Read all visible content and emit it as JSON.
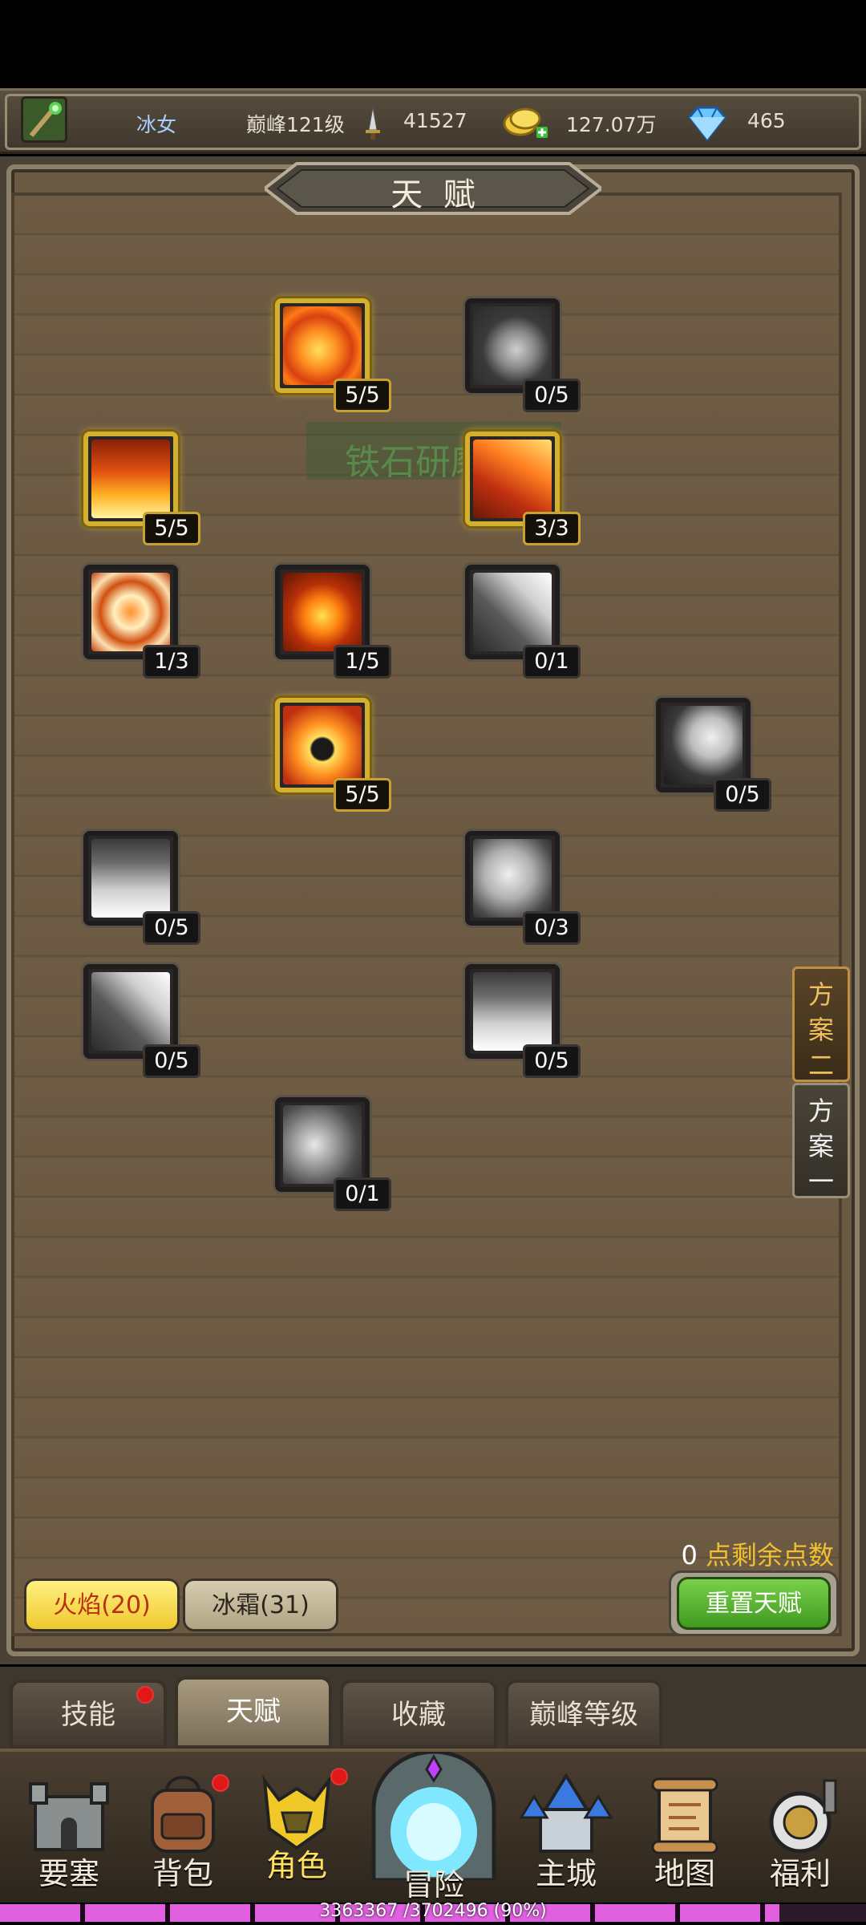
{
  "header": {
    "hero_name": "冰女",
    "peak_level": "巅峰121级",
    "power": "41527",
    "gold": "127.07万",
    "diamonds": "465"
  },
  "title": "天  赋",
  "watermark": "铁石研磨",
  "talents": [
    {
      "name": "fire-orb-talent",
      "level": "5/5",
      "active": true
    },
    {
      "name": "stone-meteor-talent",
      "level": "0/5",
      "active": false
    },
    {
      "name": "flame-burst-talent",
      "level": "5/5",
      "active": true
    },
    {
      "name": "fire-streak-talent",
      "level": "3/3",
      "active": true
    },
    {
      "name": "fire-rune-talent",
      "level": "1/3",
      "active": false
    },
    {
      "name": "fire-meteor-talent",
      "level": "1/5",
      "active": false
    },
    {
      "name": "comet-talent",
      "level": "0/1",
      "active": false
    },
    {
      "name": "warrior-flame-talent",
      "level": "5/5",
      "active": true
    },
    {
      "name": "fist-talent",
      "level": "0/5",
      "active": false
    },
    {
      "name": "white-flame-talent",
      "level": "0/5",
      "active": false
    },
    {
      "name": "rage-face-talent",
      "level": "0/3",
      "active": false
    },
    {
      "name": "comet-2-talent",
      "level": "0/5",
      "active": false
    },
    {
      "name": "white-flame-2-talent",
      "level": "0/5",
      "active": false
    },
    {
      "name": "frost-splash-talent",
      "level": "0/1",
      "active": false
    }
  ],
  "plans": {
    "plan2": "方案二",
    "plan1": "方案一"
  },
  "remaining_points": {
    "count": "0",
    "label": "点剩余点数"
  },
  "element_tabs": {
    "fire": "火焰(20)",
    "frost": "冰霜(31)"
  },
  "reset_button": "重置天赋",
  "sub_tabs": [
    "技能",
    "天赋",
    "收藏",
    "巅峰等级"
  ],
  "nav": [
    "要塞",
    "背包",
    "角色",
    "冒险",
    "主城",
    "地图",
    "福利"
  ],
  "xp_text": "3363367 /3702496 (90%)",
  "xp_progress": 0.9,
  "colors": {
    "accent_gold": "#f0c030",
    "fire": "#e86a10",
    "active_green": "#4a9a2a"
  }
}
